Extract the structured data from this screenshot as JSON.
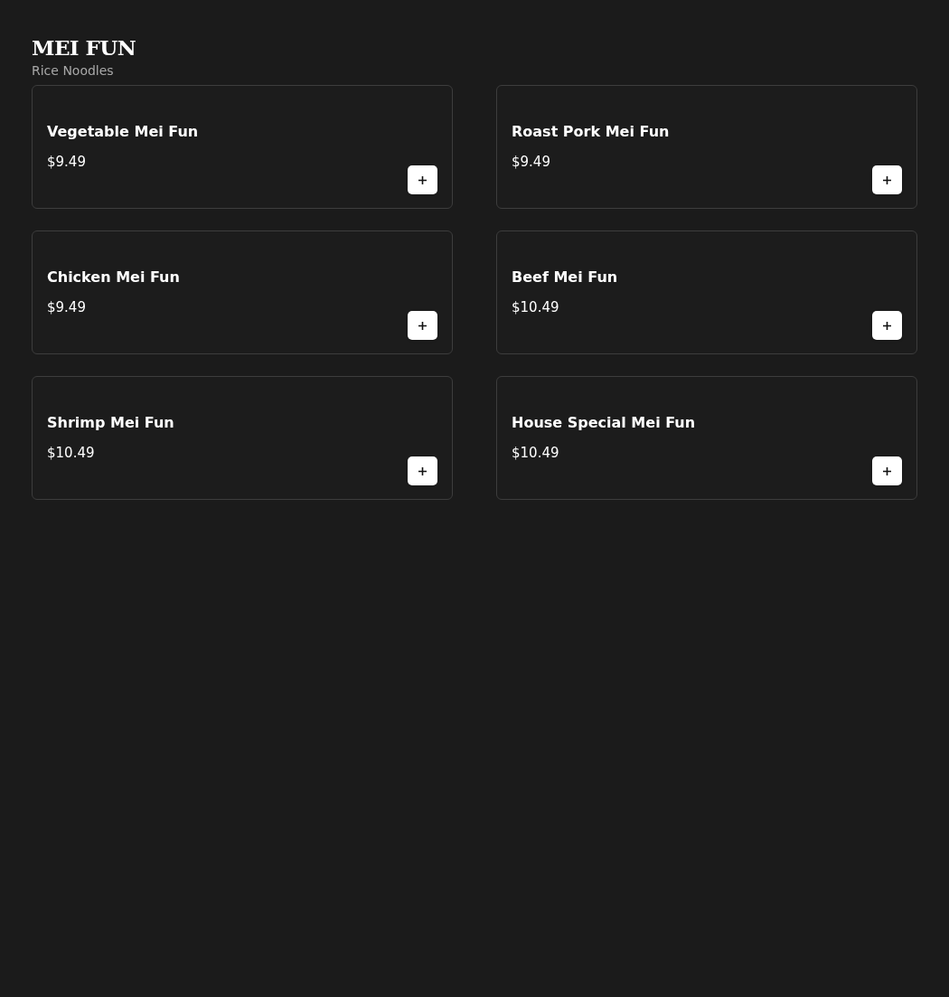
{
  "header": {
    "title": "MEI FUN",
    "subtitle": "Rice Noodles"
  },
  "items": [
    {
      "name": "Vegetable Mei Fun",
      "price": "$9.49"
    },
    {
      "name": "Roast Pork Mei Fun",
      "price": "$9.49"
    },
    {
      "name": "Chicken Mei Fun",
      "price": "$9.49"
    },
    {
      "name": "Beef Mei Fun",
      "price": "$10.49"
    },
    {
      "name": "Shrimp Mei Fun",
      "price": "$10.49"
    },
    {
      "name": "House Special Mei Fun",
      "price": "$10.49"
    }
  ]
}
